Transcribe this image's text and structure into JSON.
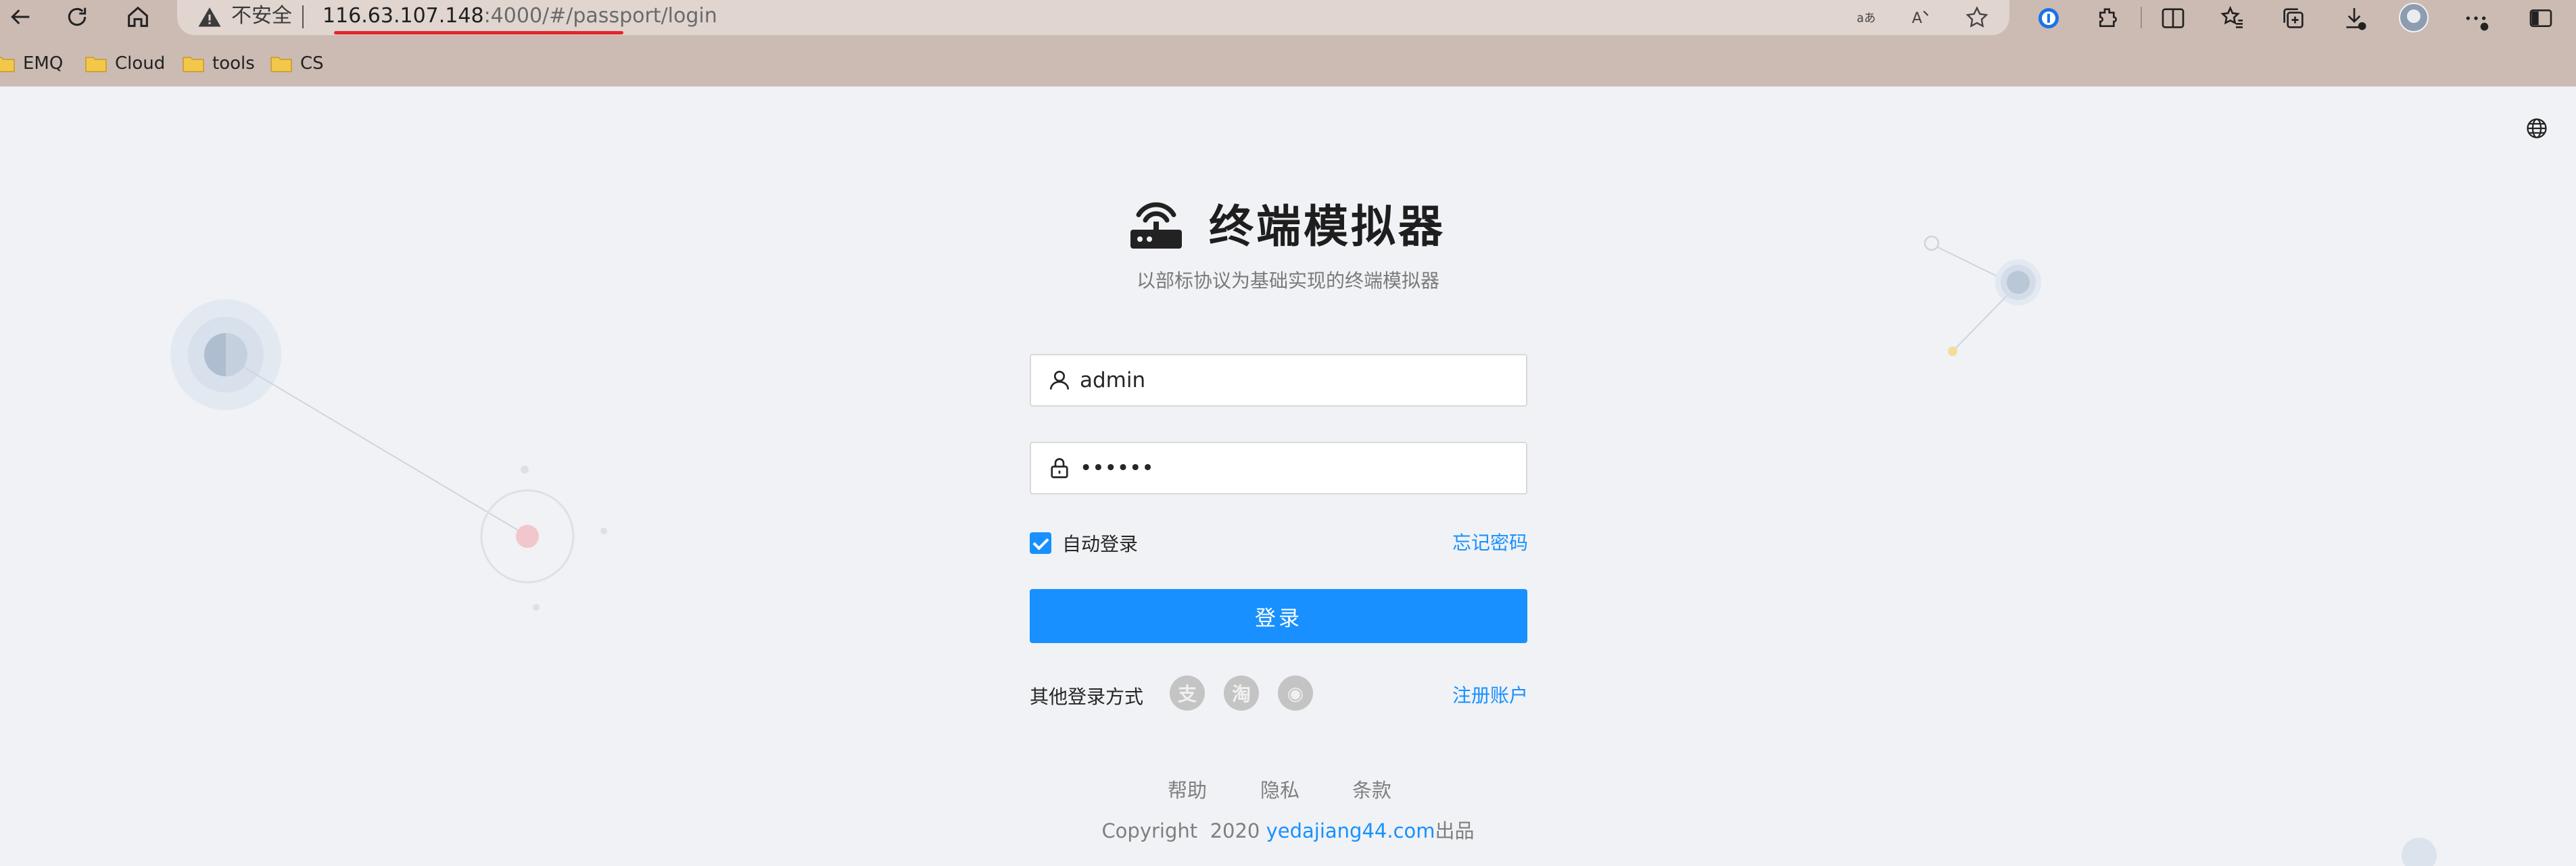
{
  "browser": {
    "security_label": "不安全",
    "url_host": "116.63.107.148",
    "url_rest": ":4000/#/passport/login",
    "bookmarks": [
      {
        "label": "EMQ"
      },
      {
        "label": "Cloud"
      },
      {
        "label": "tools"
      },
      {
        "label": "CS"
      }
    ],
    "icons": [
      "back-icon",
      "reload-icon",
      "home-icon",
      "warning-icon",
      "read-aloud-icon",
      "translate-icon",
      "favorite-star-icon",
      "password-manager-icon",
      "extensions-icon",
      "split-screen-icon",
      "favorites-icon",
      "collections-icon",
      "downloads-icon",
      "profile-avatar",
      "more-icon",
      "sidebar-icon"
    ]
  },
  "login": {
    "title": "终端模拟器",
    "subtitle": "以部标协议为基础实现的终端模拟器",
    "username_value": "admin",
    "password_value": "••••••",
    "remember_label": "自动登录",
    "remember_checked": true,
    "forgot_label": "忘记密码",
    "submit_label": "登录",
    "other_methods_label": "其他登录方式",
    "social": [
      {
        "glyph": "支",
        "icon": "alipay-icon"
      },
      {
        "glyph": "淘",
        "icon": "taobao-icon"
      },
      {
        "glyph": "◉",
        "icon": "weibo-icon"
      }
    ],
    "register_label": "注册账户"
  },
  "footer": {
    "links": [
      {
        "label": "帮助"
      },
      {
        "label": "隐私"
      },
      {
        "label": "条款"
      }
    ],
    "copyright_prefix": "Copyright  2020 ",
    "copyright_link": "yedajiang44.com",
    "copyright_suffix": "出品"
  },
  "colors": {
    "primary": "#1890ff",
    "background": "#f0f2f5",
    "chrome": "#cbbbb3",
    "url_underline": "#e3262b"
  }
}
